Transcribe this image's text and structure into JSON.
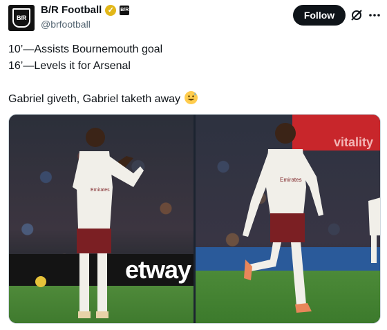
{
  "account": {
    "display_name": "B/R Football",
    "handle": "@brfootball",
    "avatar_text": "B/R",
    "affiliate_badge_text": "B/R"
  },
  "actions": {
    "follow_label": "Follow",
    "icons": [
      "grok-icon",
      "more-icon"
    ]
  },
  "tweet": {
    "lines": [
      "10’—Assists Bournemouth goal",
      "16’—Levels it for Arsenal",
      "Gabriel giveth, Gabriel taketh away"
    ],
    "emoji": "grinning-sweat-emoji"
  },
  "media": {
    "left_photo": {
      "board_text": "etway",
      "jersey_text": "Emirates"
    },
    "right_photo": {
      "banner_text": "vitality",
      "jersey_text": "Emirates"
    }
  },
  "colors": {
    "follow_bg": "#0f1419",
    "handle": "#536471",
    "verified": "#e2b719"
  }
}
